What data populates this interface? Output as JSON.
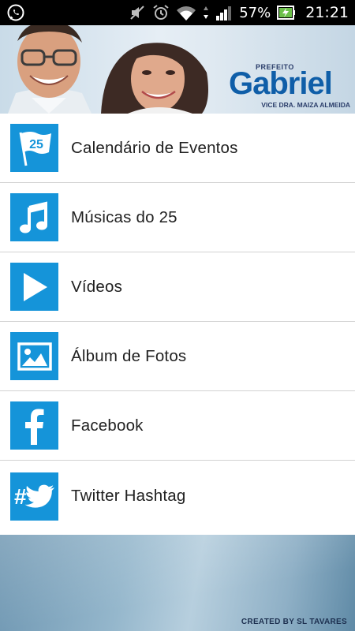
{
  "status_bar": {
    "battery_percent": "57%",
    "time": "21:21",
    "icons": [
      "whatsapp-icon",
      "mute-icon",
      "alarm-icon",
      "wifi-icon",
      "data-arrows-icon",
      "signal-icon",
      "battery-charging-icon"
    ]
  },
  "banner": {
    "prefix": "PREFEITO",
    "name": "Gabriel",
    "vice": "VICE DRA. MAIZA ALMEIDA"
  },
  "menu": {
    "items": [
      {
        "label": "Calendário de Eventos",
        "icon": "calendar-flag-icon",
        "icon_text": "25"
      },
      {
        "label": "Músicas do 25",
        "icon": "music-note-icon"
      },
      {
        "label": "Vídeos",
        "icon": "play-icon"
      },
      {
        "label": "Álbum de Fotos",
        "icon": "photo-album-icon"
      },
      {
        "label": "Facebook",
        "icon": "facebook-icon"
      },
      {
        "label": "Twitter Hashtag",
        "icon": "twitter-hashtag-icon"
      }
    ]
  },
  "footer": {
    "credit": "CREATED BY SL TAVARES"
  },
  "colors": {
    "icon_tile": "#1594d9",
    "brand_blue": "#0f5ea8",
    "divider": "#d2d2d2"
  }
}
